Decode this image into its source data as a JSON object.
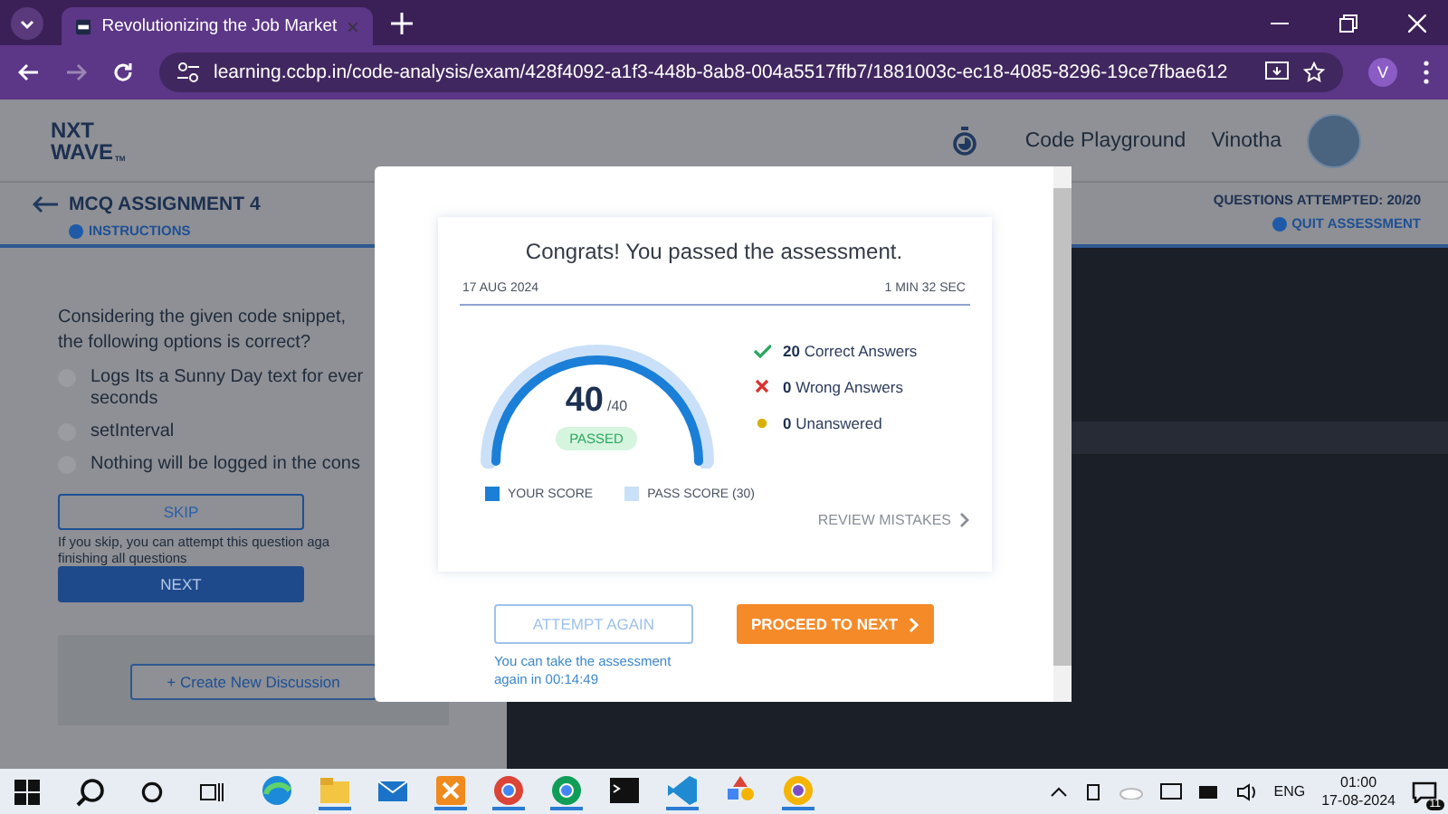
{
  "browser": {
    "tab_title": "Revolutionizing the Job Market",
    "url": "learning.ccbp.in/code-analysis/exam/428f4092-a1f3-448b-8ab8-004a5517ffb7/1881003c-ec18-4085-8296-19ce7fbae612",
    "profile": "V"
  },
  "header": {
    "logo": [
      "NXT",
      "WAVE"
    ],
    "logo_mark": "TM",
    "playground": "Code Playground",
    "user": "Vinotha"
  },
  "subbar": {
    "title": "MCQ ASSIGNMENT 4",
    "instructions": "INSTRUCTIONS",
    "attempted": "QUESTIONS ATTEMPTED: 20/20",
    "quit": "QUIT ASSESSMENT"
  },
  "question": {
    "text": "Considering the given code snippet, the following options is correct?",
    "options": [
      {
        "label": "Logs Its a Sunny Day text for ever seconds",
        "selected": false
      },
      {
        "label": "setInterval",
        "selected": false
      },
      {
        "label": "Nothing will be logged in the cons",
        "selected": false
      }
    ],
    "skip": "SKIP",
    "skip_note": "If you skip, you can attempt this question aga finishing all questions",
    "next": "NEXT",
    "discussion": "+ Create New Discussion"
  },
  "modal": {
    "title": "Congrats! You passed the assessment.",
    "date": "17 AUG 2024",
    "duration": "1 MIN 32 SEC",
    "score": "40",
    "total": "/40",
    "level": 1,
    "status": "PASSED",
    "stats": [
      {
        "kind": "correct",
        "text": "**20** Correct Answers"
      },
      {
        "kind": "wrong",
        "text": "**0** Wrong Answers"
      },
      {
        "kind": "unanswered",
        "text": "**0** Unanswered"
      }
    ],
    "legend": [
      {
        "label": "YOUR SCORE",
        "color": "#1b7fd8"
      },
      {
        "label": "PASS SCORE (30)",
        "color": "#c9e0f8"
      }
    ],
    "review": "REVIEW MISTAKES",
    "attempt": "ATTEMPT AGAIN",
    "proceed": "PROCEED TO NEXT",
    "retake_note": "You can take the assessment again in 00:14:49"
  },
  "taskbar": {
    "language": "ENG",
    "time": "01:00",
    "date": "17-08-2024",
    "notifications": "11"
  }
}
